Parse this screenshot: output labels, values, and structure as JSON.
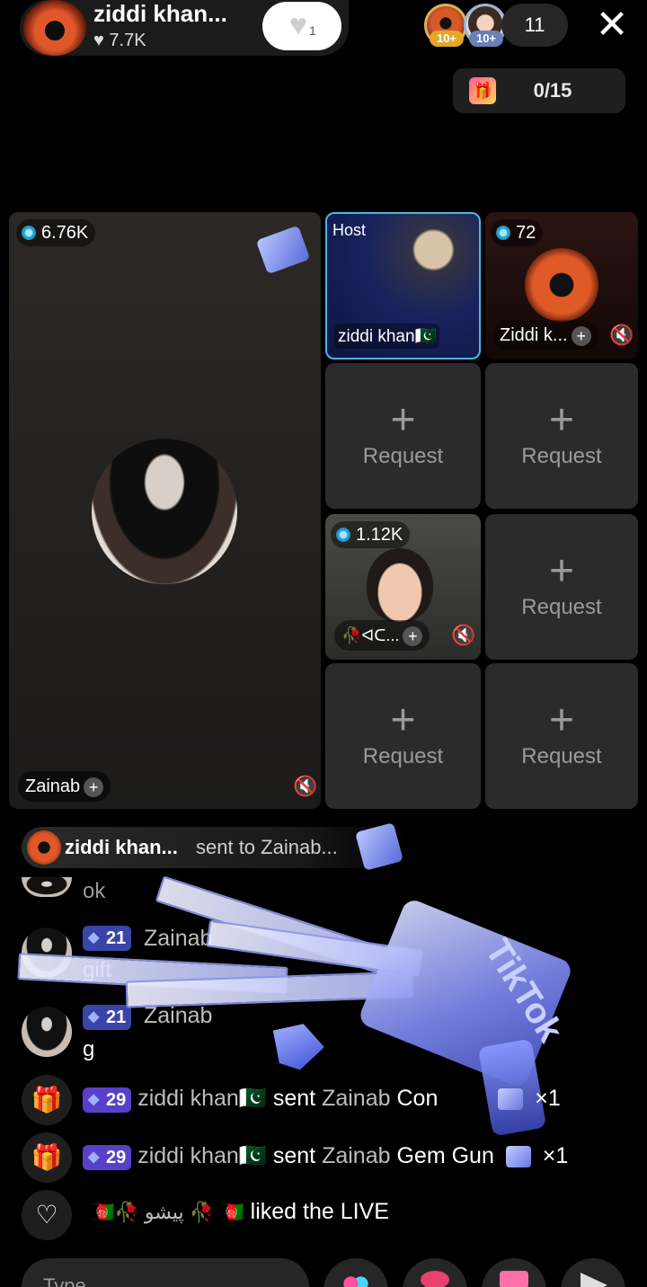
{
  "header": {
    "host_name": "ziddi khan...",
    "host_likes": "♥ 7.7K",
    "follow_count": "1",
    "viewer_badges": [
      "10+",
      "10+"
    ],
    "viewer_count": "11",
    "close_icon": "close-icon",
    "goal_text": "0/15"
  },
  "grid": {
    "main": {
      "coins": "6.76K",
      "name": "Zainab"
    },
    "host_tile": {
      "label": "Host",
      "name": "ziddi khan🇵🇰"
    },
    "ziddi_tile": {
      "coins": "72",
      "name": "Ziddi k..."
    },
    "guest_tile": {
      "coins": "1.12K",
      "name": "🥀ᐊᑕ..."
    },
    "request_plus": "+",
    "request_label": "Request"
  },
  "chat": {
    "gift_banner": {
      "name": "ziddi khan...",
      "text": "sent to Zainab..."
    },
    "partial_msg": "ok",
    "messages": [
      {
        "level": "21",
        "name": "Zainab",
        "text": "gift"
      },
      {
        "level": "21",
        "name": "Zainab",
        "text": "g"
      }
    ],
    "system": [
      {
        "level": "29",
        "name": "ziddi khan🇵🇰",
        "verb": "sent",
        "target": "Zainab",
        "gift": "Con",
        "count": "×1"
      },
      {
        "level": "29",
        "name": "ziddi khan🇵🇰",
        "verb": "sent",
        "target": "Zainab",
        "gift": "Gem Gun",
        "count": "×1"
      }
    ],
    "like_line": {
      "name": "🇦🇫🥀 پیشو 🥀 🇦🇫",
      "text": "liked the LIVE"
    }
  },
  "bottom": {
    "input_placeholder": "Type..."
  },
  "colors": {
    "accent": "#49b7e6",
    "badge_blue": "#3a44a8",
    "badge_purple": "#5840c8"
  }
}
